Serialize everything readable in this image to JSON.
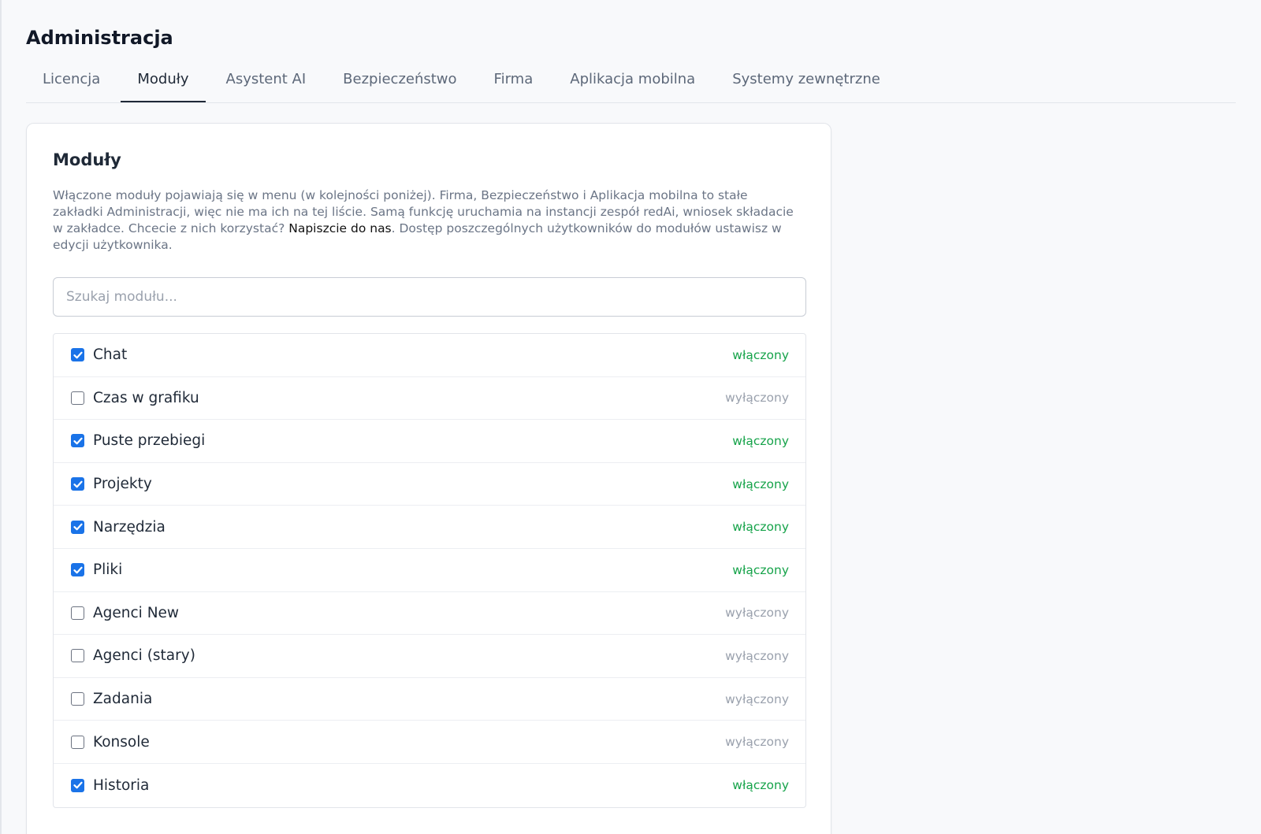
{
  "page_title": "Administracja",
  "tabs": [
    {
      "label": "Licencja",
      "active": false
    },
    {
      "label": "Moduły",
      "active": true
    },
    {
      "label": "Asystent AI",
      "active": false
    },
    {
      "label": "Bezpieczeństwo",
      "active": false
    },
    {
      "label": "Firma",
      "active": false
    },
    {
      "label": "Aplikacja mobilna",
      "active": false
    },
    {
      "label": "Systemy zewnętrzne",
      "active": false
    }
  ],
  "card": {
    "title": "Moduły",
    "description_before": "Włączone moduły pojawiają się w menu (w kolejności poniżej). Firma, Bezpieczeństwo i Aplikacja mobilna to stałe zakładki Administracji, więc nie ma ich na tej liście. Samą funkcję uruchamia na instancji zespół redAi, wniosek składacie w zakładce. Chcecie z nich korzystać? ",
    "description_link": "Napiszcie do nas",
    "description_after": ". Dostęp poszczególnych użytkowników do modułów ustawisz w edycji użytkownika.",
    "search_placeholder": "Szukaj modułu...",
    "search_value": ""
  },
  "modules": [
    {
      "name": "Chat",
      "enabled": true,
      "status": "włączony"
    },
    {
      "name": "Czas w grafiku",
      "enabled": false,
      "status": "wyłączony"
    },
    {
      "name": "Puste przebiegi",
      "enabled": true,
      "status": "włączony"
    },
    {
      "name": "Projekty",
      "enabled": true,
      "status": "włączony"
    },
    {
      "name": "Narzędzia",
      "enabled": true,
      "status": "włączony"
    },
    {
      "name": "Pliki",
      "enabled": true,
      "status": "włączony"
    },
    {
      "name": "Agenci New",
      "enabled": false,
      "status": "wyłączony"
    },
    {
      "name": "Agenci (stary)",
      "enabled": false,
      "status": "wyłączony"
    },
    {
      "name": "Zadania",
      "enabled": false,
      "status": "wyłączony"
    },
    {
      "name": "Konsole",
      "enabled": false,
      "status": "wyłączony"
    },
    {
      "name": "Historia",
      "enabled": true,
      "status": "włączony"
    }
  ],
  "colors": {
    "accent": "#1a73e8",
    "enabled_status": "#16a34a",
    "disabled_status": "#9aa1ad"
  }
}
